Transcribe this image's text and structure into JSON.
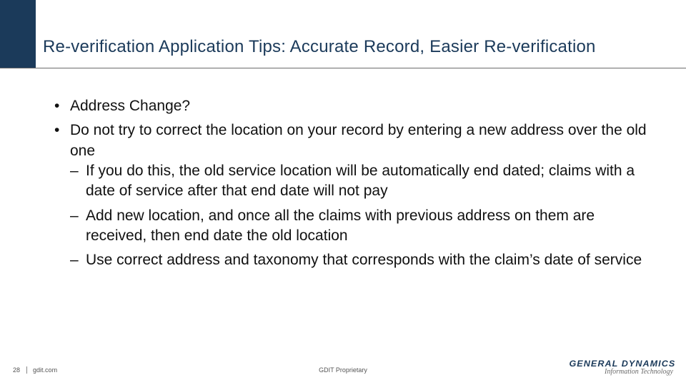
{
  "title": "Re-verification Application Tips: Accurate Record, Easier Re-verification",
  "bullets": {
    "b1": "Address Change?",
    "b2": "Do not try to correct the location on your record by entering a new address over the old one",
    "sub": {
      "s1": "If you do this, the old service location will be automatically end dated; claims with a date of service after that end date will not pay",
      "s2": "Add new location, and once all the claims with previous address on them are received, then end date the old location",
      "s3": "Use correct address and taxonomy that corresponds with the claim’s date of service"
    }
  },
  "footer": {
    "page": "28",
    "site": "gdit.com",
    "proprietary": "GDIT Proprietary",
    "logo_line1": "GENERAL DYNAMICS",
    "logo_line2": "Information Technology"
  }
}
